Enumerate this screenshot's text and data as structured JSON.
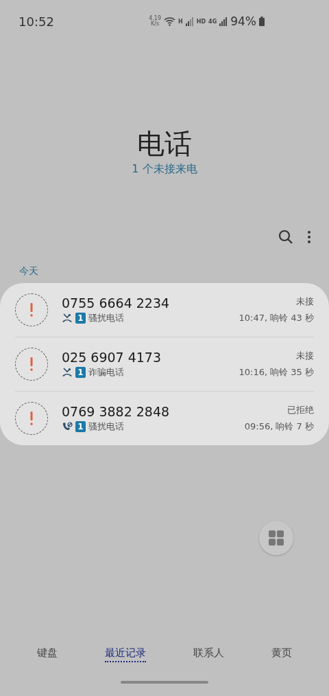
{
  "status_bar": {
    "time": "10:52",
    "net_speed": "4.19",
    "net_unit": "K/s",
    "wifi_tag": "H",
    "hd": "HD",
    "network": "4G",
    "battery": "94%"
  },
  "header": {
    "title": "电话",
    "subtitle": "1 个未接来电"
  },
  "section": "今天",
  "calls": [
    {
      "number": "0755 6664 2234",
      "kind": "missed",
      "sim": "1",
      "tag": "骚扰电话",
      "status": "未接",
      "detail": "10:47, 响铃 43 秒"
    },
    {
      "number": "025 6907 4173",
      "kind": "missed",
      "sim": "1",
      "tag": "诈骗电话",
      "status": "未接",
      "detail": "10:16, 响铃 35 秒"
    },
    {
      "number": "0769 3882 2848",
      "kind": "rejected",
      "sim": "1",
      "tag": "骚扰电话",
      "status": "已拒绝",
      "detail": "09:56, 响铃 7 秒"
    }
  ],
  "tabs": [
    {
      "label": "键盘",
      "selected": false
    },
    {
      "label": "最近记录",
      "selected": true
    },
    {
      "label": "联系人",
      "selected": false
    },
    {
      "label": "黄页",
      "selected": false
    }
  ]
}
